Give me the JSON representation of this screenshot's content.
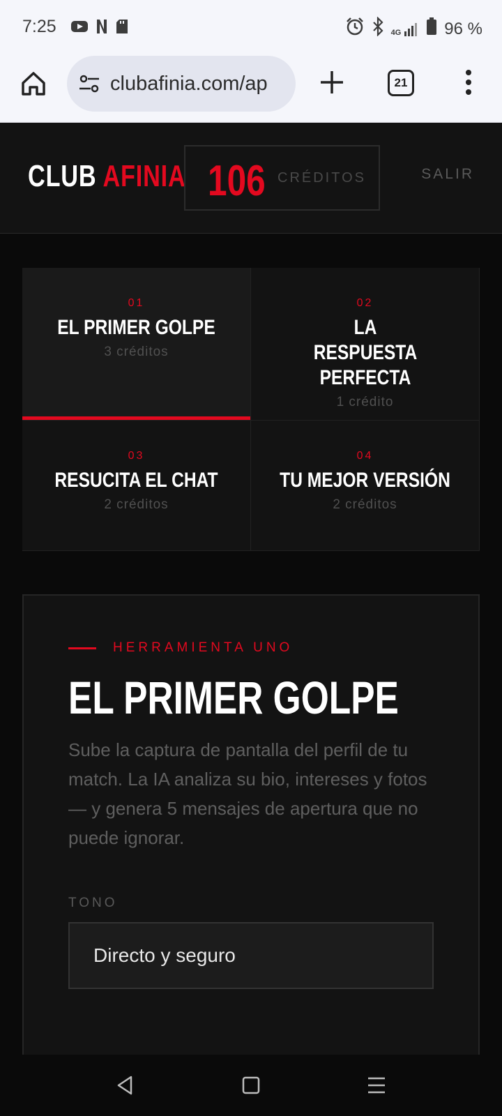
{
  "status_bar": {
    "time": "7:25",
    "battery": "96 %",
    "network": "4G",
    "left_icons": [
      "youtube-icon",
      "netflix-icon",
      "sd-card-icon"
    ],
    "right_icons": [
      "alarm-icon",
      "bluetooth-icon",
      "signal-icon",
      "battery-icon"
    ]
  },
  "browser": {
    "url": "clubafinia.com/ap",
    "tab_count": "21"
  },
  "header": {
    "brand_white": "CLUB",
    "brand_red": "AFINIA",
    "credits_value": "106",
    "credits_label": "CRÉDITOS",
    "logout_label": "SALIR"
  },
  "tools": [
    {
      "num": "01",
      "title": "EL PRIMER GOLPE",
      "cost": "3 créditos",
      "active": true
    },
    {
      "num": "02",
      "title": "LA RESPUESTA PERFECTA",
      "cost": "1 crédito",
      "active": false
    },
    {
      "num": "03",
      "title": "RESUCITA EL CHAT",
      "cost": "2 créditos",
      "active": false
    },
    {
      "num": "04",
      "title": "TU MEJOR VERSIÓN",
      "cost": "2 créditos",
      "active": false
    }
  ],
  "panel": {
    "eyebrow": "HERRAMIENTA UNO",
    "title": "EL PRIMER GOLPE",
    "description": "Sube la captura de pantalla del perfil de tu match. La IA analiza su bio, intereses y fotos — y genera 5 mensajes de apertura que no puede ignorar.",
    "tone_label": "TONO",
    "tone_value": "Directo y seguro"
  },
  "colors": {
    "accent": "#e3091f",
    "background": "#0a0a0a",
    "surface": "#131313"
  }
}
